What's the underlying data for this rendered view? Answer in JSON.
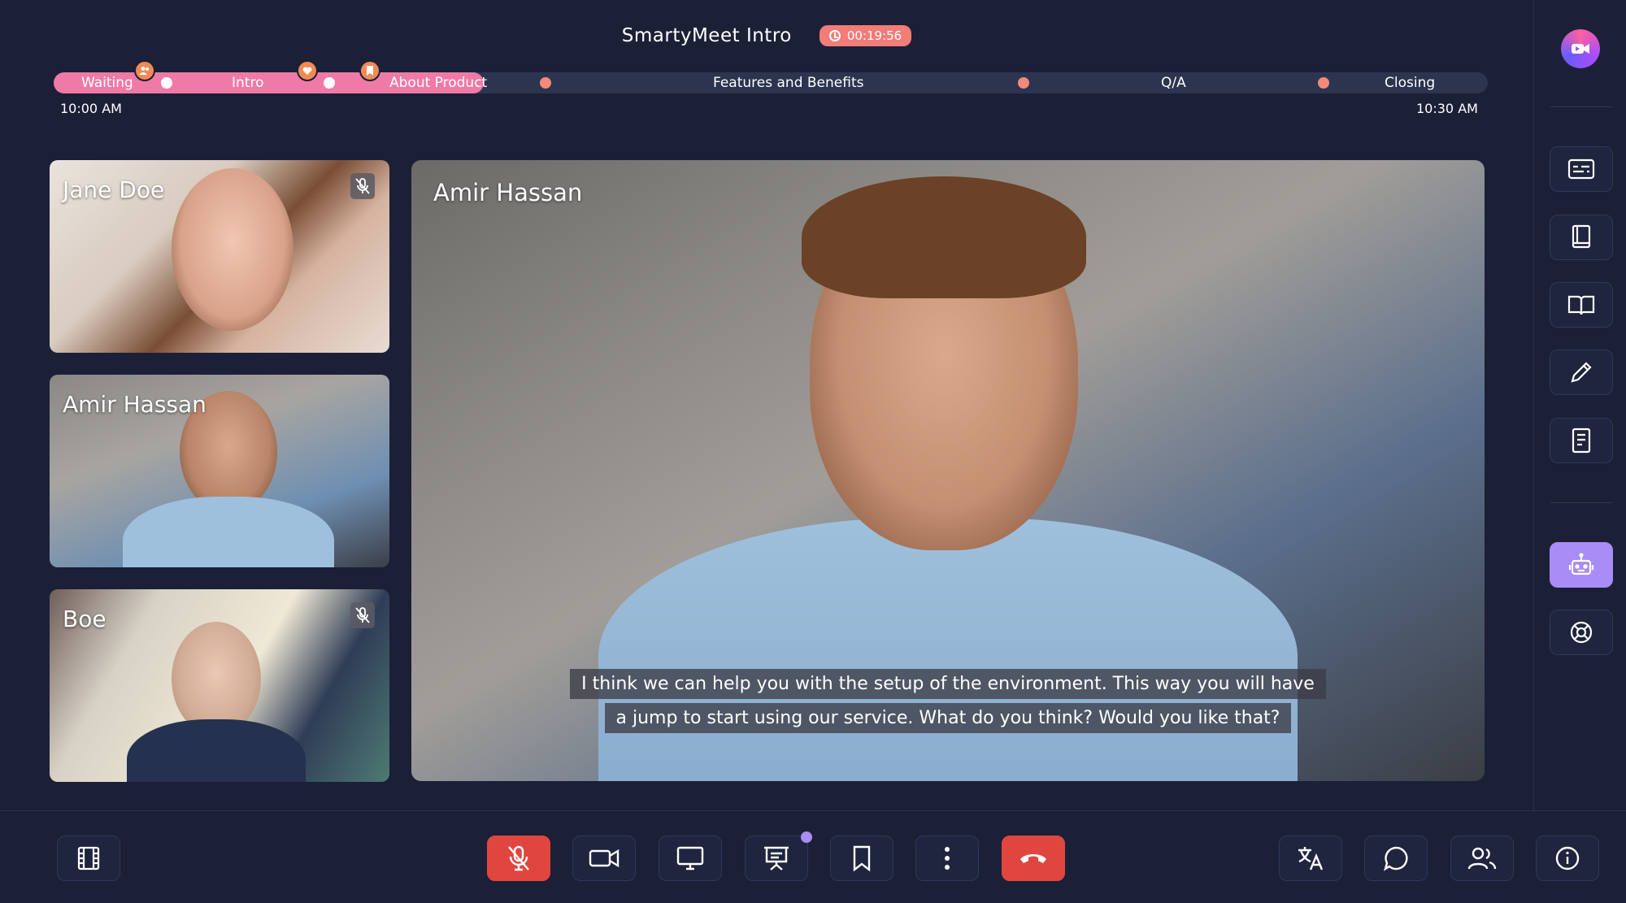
{
  "header": {
    "title": "SmartyMeet Intro",
    "timer": "00:19:56"
  },
  "timeline": {
    "start_time": "10:00 AM",
    "end_time": "10:30 AM",
    "progress": 0.3,
    "segments": [
      {
        "label": "Waiting"
      },
      {
        "label": "Intro"
      },
      {
        "label": "About Product"
      },
      {
        "label": "Features and Benefits"
      },
      {
        "label": "Q/A"
      },
      {
        "label": "Closing"
      }
    ]
  },
  "participants": [
    {
      "name": "Jane Doe",
      "muted": true
    },
    {
      "name": "Amir Hassan",
      "muted": false
    },
    {
      "name": "Boe",
      "muted": true
    }
  ],
  "stage": {
    "name": "Amir Hassan",
    "caption_line1": "I think we can help you with the setup of the environment. This way you will have",
    "caption_line2": "a jump to start using our service. What do you think? Would you like that?"
  },
  "rail": {
    "items": [
      {
        "icon": "captions-icon"
      },
      {
        "icon": "notebook-icon"
      },
      {
        "icon": "book-open-icon"
      },
      {
        "icon": "pencil-icon"
      },
      {
        "icon": "document-icon"
      },
      {
        "icon": "robot-icon",
        "active": true
      },
      {
        "icon": "lifebuoy-icon"
      }
    ]
  },
  "toolbar": {
    "left": [
      {
        "icon": "film-icon"
      }
    ],
    "center": [
      {
        "icon": "mic-off-icon",
        "state": "muted"
      },
      {
        "icon": "video-camera-icon"
      },
      {
        "icon": "monitor-icon"
      },
      {
        "icon": "presentation-icon",
        "badge": true
      },
      {
        "icon": "bookmark-icon"
      },
      {
        "icon": "more-vertical-icon"
      },
      {
        "icon": "hang-up-icon"
      }
    ],
    "right": [
      {
        "icon": "translate-icon"
      },
      {
        "icon": "chat-icon"
      },
      {
        "icon": "participants-icon"
      },
      {
        "icon": "info-icon"
      }
    ]
  },
  "colors": {
    "background": "#1b2037",
    "accent": "#a98cf5",
    "progress": "#f07aa6",
    "danger": "#e0463f",
    "timer": "#f27c78"
  }
}
